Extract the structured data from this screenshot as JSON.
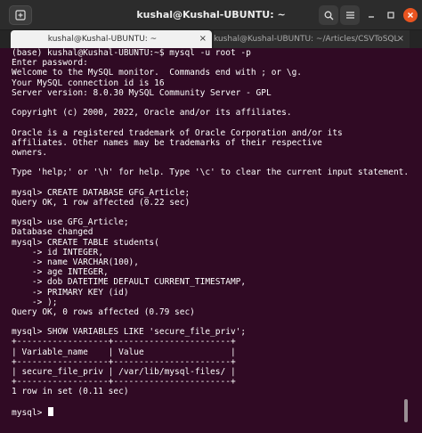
{
  "window": {
    "title": "kushal@Kushal-UBUNTU: ~"
  },
  "tabs": [
    {
      "label": "kushal@Kushal-UBUNTU: ~",
      "active": true
    },
    {
      "label": "kushal@Kushal-UBUNTU: ~/Articles/CSVToSQL",
      "active": false
    }
  ],
  "colors": {
    "terminal_bg": "#300a24",
    "titlebar_bg": "#2c2c2c",
    "close_button": "#e95420",
    "text": "#ffffff"
  },
  "icons": {
    "new_tab": "new-tab-icon",
    "search": "search-icon",
    "menu": "hamburger-menu-icon",
    "minimize": "minimize-icon",
    "maximize": "maximize-icon",
    "close": "close-icon"
  },
  "terminal": {
    "lines": [
      "(base) kushal@Kushal-UBUNTU:~$ mysql -u root -p",
      "Enter password:",
      "Welcome to the MySQL monitor.  Commands end with ; or \\g.",
      "Your MySQL connection id is 16",
      "Server version: 8.0.30 MySQL Community Server - GPL",
      "",
      "Copyright (c) 2000, 2022, Oracle and/or its affiliates.",
      "",
      "Oracle is a registered trademark of Oracle Corporation and/or its",
      "affiliates. Other names may be trademarks of their respective",
      "owners.",
      "",
      "Type 'help;' or '\\h' for help. Type '\\c' to clear the current input statement.",
      "",
      "mysql> CREATE DATABASE GFG_Article;",
      "Query OK, 1 row affected (0.22 sec)",
      "",
      "mysql> use GFG_Article;",
      "Database changed",
      "mysql> CREATE TABLE students(",
      "    -> id INTEGER,",
      "    -> name VARCHAR(100),",
      "    -> age INTEGER,",
      "    -> dob DATETIME DEFAULT CURRENT_TIMESTAMP,",
      "    -> PRIMARY KEY (id)",
      "    -> );",
      "Query OK, 0 rows affected (0.79 sec)",
      "",
      "mysql> SHOW VARIABLES LIKE 'secure_file_priv';",
      "+------------------+-----------------------+",
      "| Variable_name    | Value                 |",
      "+------------------+-----------------------+",
      "| secure_file_priv | /var/lib/mysql-files/ |",
      "+------------------+-----------------------+",
      "1 row in set (0.11 sec)",
      "",
      "mysql> "
    ]
  }
}
